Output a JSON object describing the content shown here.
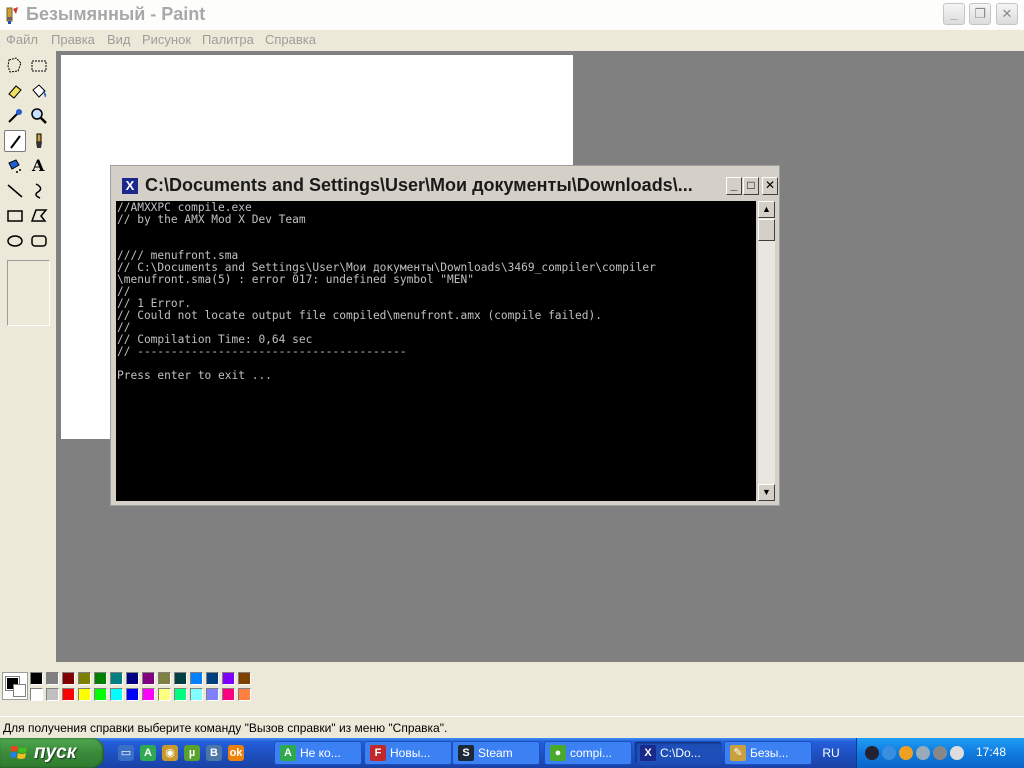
{
  "window": {
    "title": "Безымянный - Paint",
    "minimize_glyph": "_",
    "maximize_glyph": "❐",
    "close_glyph": "✕"
  },
  "menu": [
    "Файл",
    "Правка",
    "Вид",
    "Рисунок",
    "Палитра",
    "Справка"
  ],
  "toolbox": {
    "tools": [
      "free-form-select",
      "rect-select",
      "eraser",
      "fill",
      "color-picker",
      "magnifier",
      "pencil",
      "brush",
      "airbrush",
      "text",
      "line",
      "curve",
      "rectangle",
      "polygon",
      "ellipse",
      "rounded-rectangle"
    ],
    "active": "pencil",
    "text_glyph": "A"
  },
  "palette": {
    "foreground": "#000000",
    "background": "#ffffff",
    "row1": [
      "#000000",
      "#808080",
      "#800000",
      "#808000",
      "#008000",
      "#008080",
      "#000080",
      "#800080",
      "#808040",
      "#004040",
      "#0080ff",
      "#004080",
      "#8000ff",
      "#804000"
    ],
    "row2": [
      "#ffffff",
      "#c0c0c0",
      "#ff0000",
      "#ffff00",
      "#00ff00",
      "#00ffff",
      "#0000ff",
      "#ff00ff",
      "#ffff80",
      "#00ff80",
      "#80ffff",
      "#8080ff",
      "#ff0080",
      "#ff8040"
    ]
  },
  "status": {
    "text": "Для получения справки выберите команду \"Вызов справки\" из меню \"Справка\"."
  },
  "console": {
    "title": "C:\\Documents and Settings\\User\\Мои документы\\Downloads\\...",
    "icon_glyph": "X",
    "minimize_glyph": "_",
    "maximize_glyph": "□",
    "close_glyph": "✕",
    "lines": [
      "//AMXXPC compile.exe",
      "// by the AMX Mod X Dev Team",
      "",
      "",
      "//// menufront.sma",
      "// C:\\Documents and Settings\\User\\Мои документы\\Downloads\\3469_compiler\\compiler",
      "\\menufront.sma(5) : error 017: undefined symbol \"MEN\"",
      "//",
      "// 1 Error.",
      "// Could not locate output file compiled\\menufront.amx (compile failed).",
      "//",
      "// Compilation Time: 0,64 sec",
      "// ----------------------------------------",
      "",
      "Press enter to exit ..."
    ],
    "scroll_up": "▲",
    "scroll_down": "▼"
  },
  "taskbar": {
    "start_label": "пуск",
    "quicklaunch": [
      {
        "name": "show-desktop",
        "glyph": "▭",
        "color": "#3a6fc8"
      },
      {
        "name": "agent",
        "glyph": "A",
        "color": "#2fa84f"
      },
      {
        "name": "media",
        "glyph": "◉",
        "color": "#c89a2a"
      },
      {
        "name": "utorrent",
        "glyph": "µ",
        "color": "#5aa02c"
      },
      {
        "name": "vkontakte",
        "glyph": "B",
        "color": "#4a76a8"
      },
      {
        "name": "odnoklassniki",
        "glyph": "ok",
        "color": "#ee8208"
      }
    ],
    "tasks": [
      {
        "label": "Не ко...",
        "glyph": "A",
        "color": "#2fa84f",
        "active": false
      },
      {
        "label": "Новы...",
        "glyph": "F",
        "color": "#c0282c",
        "active": false
      },
      {
        "label": "Steam",
        "glyph": "S",
        "color": "#1b2838",
        "active": false
      },
      {
        "label": "compi...",
        "glyph": "●",
        "color": "#4aa82c",
        "active": false
      },
      {
        "label": "C:\\Do...",
        "glyph": "X",
        "color": "#1a2a8c",
        "active": true
      },
      {
        "label": "Безы...",
        "glyph": "✎",
        "color": "#c8a040",
        "active": false
      }
    ],
    "language": "RU",
    "clock": "17:48",
    "tray": [
      {
        "name": "steam-tray",
        "color": "#223"
      },
      {
        "name": "network-tray",
        "color": "#3a8ee0"
      },
      {
        "name": "orange-tray",
        "color": "#f0a020"
      },
      {
        "name": "monitor-tray",
        "color": "#9ab"
      },
      {
        "name": "update-tray",
        "color": "#888"
      },
      {
        "name": "speaker-tray",
        "color": "#ddd"
      }
    ]
  }
}
